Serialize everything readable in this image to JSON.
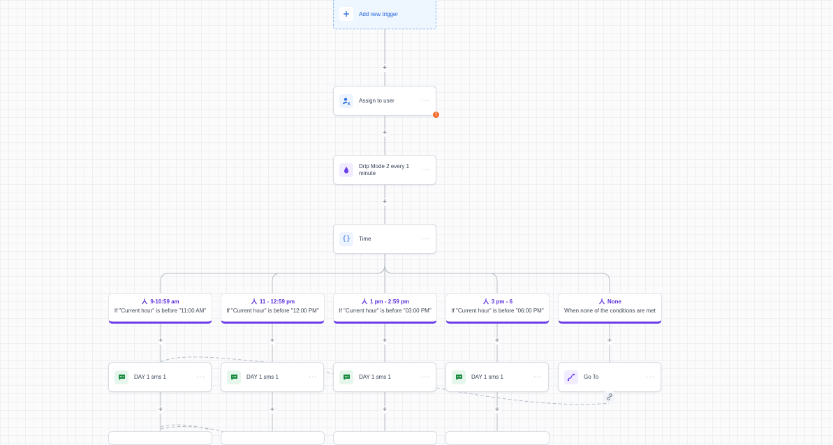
{
  "trigger": {
    "label": "Add new trigger",
    "icon": "plus-icon"
  },
  "actions": {
    "assign": {
      "label": "Assign to user",
      "icon": "user-assign-icon",
      "more": "···",
      "warning": "!"
    },
    "drip": {
      "label": "Drip Mode 2 every 1 minute",
      "icon": "drip-icon",
      "more": "···"
    },
    "time": {
      "label": "Time",
      "icon": "curly-braces-icon",
      "more": "···"
    }
  },
  "branches": [
    {
      "title": "9-10:59 am",
      "subtitle": "If \"Current hour\" is before \"11:00 AM\""
    },
    {
      "title": "11 - 12:59 pm",
      "subtitle": "If \"Current hour\" is before \"12:00 PM\""
    },
    {
      "title": "1 pm - 2:59 pm",
      "subtitle": "If \"Current hour\" is before \"03:00 PM\""
    },
    {
      "title": "3 pm - 6",
      "subtitle": "If \"Current hour\" is before \"06:00 PM\""
    },
    {
      "title": "None",
      "subtitle": "When none of the conditions are met"
    }
  ],
  "step_nodes": [
    {
      "label": "DAY 1 sms 1",
      "icon": "sms-icon",
      "more": "···"
    },
    {
      "label": "DAY 1 sms 1",
      "icon": "sms-icon",
      "more": "···"
    },
    {
      "label": "DAY 1 sms 1",
      "icon": "sms-icon",
      "more": "···"
    },
    {
      "label": "DAY 1 sms 1",
      "icon": "sms-icon",
      "more": "···"
    },
    {
      "label": "Go To",
      "icon": "goto-icon",
      "more": "···"
    }
  ],
  "add_step_symbol": "+",
  "colors": {
    "accent": "#6a3de8",
    "trigger_blue": "#1f63d6",
    "sms_green": "#178a3e",
    "warning": "#f56a2a"
  }
}
